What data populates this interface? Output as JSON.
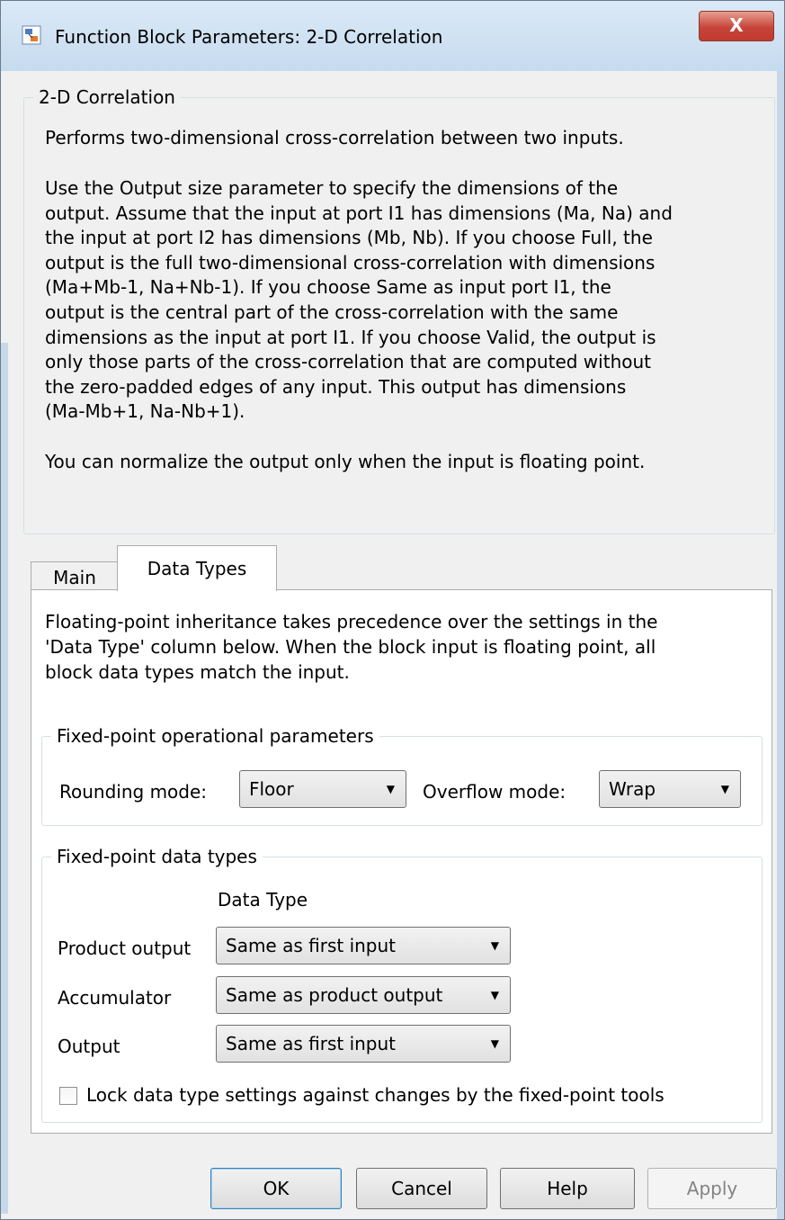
{
  "window": {
    "title": "Function Block Parameters: 2-D Correlation",
    "close_label": "X"
  },
  "description": {
    "group_title": "2-D Correlation",
    "lines": [
      "Performs two-dimensional cross-correlation between two inputs.",
      "",
      "Use the Output size parameter to specify the dimensions of the",
      "output. Assume that the input at port I1 has dimensions (Ma, Na) and",
      "the input at port I2 has dimensions (Mb, Nb). If you choose Full, the",
      "output is the full two-dimensional cross-correlation with dimensions",
      "(Ma+Mb-1, Na+Nb-1). If you choose Same as input port I1, the",
      "output is the central part of the cross-correlation with the same",
      "dimensions as the input at port I1. If you choose Valid, the output is",
      "only those parts of the cross-correlation that are computed without",
      "the zero-padded edges of any input. This output has dimensions",
      "(Ma-Mb+1, Na-Nb+1).",
      "",
      "You can normalize the output only when the input is floating point."
    ]
  },
  "tabs": [
    {
      "label": "Main",
      "selected": false
    },
    {
      "label": "Data Types",
      "selected": true
    }
  ],
  "data_types_tab": {
    "info_lines": [
      "Floating-point inheritance takes precedence over the settings in the",
      "'Data Type' column below. When the block input is floating point, all",
      "block data types match the input."
    ],
    "operational_params": {
      "group_title": "Fixed-point operational parameters",
      "rounding_label": "Rounding mode:",
      "rounding_value": "Floor",
      "overflow_label": "Overflow mode:",
      "overflow_value": "Wrap"
    },
    "data_types": {
      "group_title": "Fixed-point data types",
      "column_header": "Data Type",
      "rows": [
        {
          "label": "Product output",
          "value": "Same as first input"
        },
        {
          "label": "Accumulator",
          "value": "Same as product output"
        },
        {
          "label": "Output",
          "value": "Same as first input"
        }
      ],
      "lock_label": "Lock data type settings against changes by the fixed-point tools",
      "lock_checked": false
    }
  },
  "buttons": {
    "ok": "OK",
    "cancel": "Cancel",
    "help": "Help",
    "apply": "Apply"
  }
}
